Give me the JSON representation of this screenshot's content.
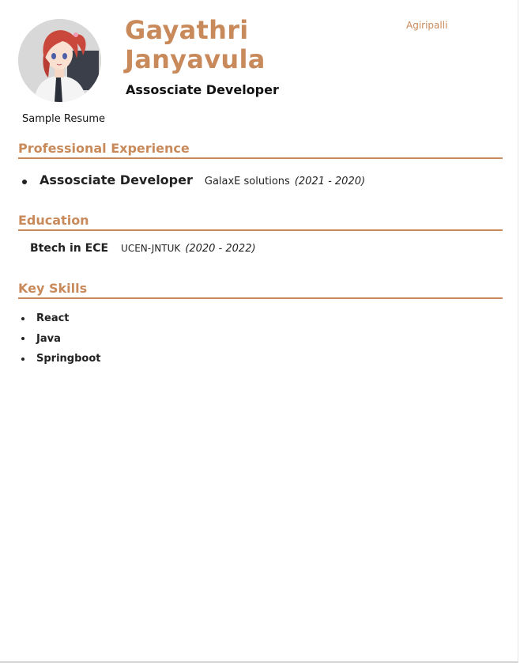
{
  "header": {
    "name_line1": "Gayathri",
    "name_line2": "Janyavula",
    "role": "Assosciate Developer",
    "location": "Agiripalli",
    "summary": "Sample Resume"
  },
  "avatar": {
    "icon": "anime-character-portrait"
  },
  "colors": {
    "accent": "#c98a5b",
    "text": "#222222"
  },
  "sections": {
    "experience": {
      "title": "Professional Experience",
      "items": [
        {
          "role": "Assosciate Developer",
          "company": "GalaxE solutions",
          "dates": "(2021 - 2020)"
        }
      ]
    },
    "education": {
      "title": "Education",
      "items": [
        {
          "degree": "Btech in ECE",
          "school": "UCEN-JNTUK",
          "dates": "(2020 - 2022)"
        }
      ]
    },
    "skills": {
      "title": "Key Skills",
      "items": [
        "React",
        "Java",
        "Springboot"
      ]
    }
  }
}
